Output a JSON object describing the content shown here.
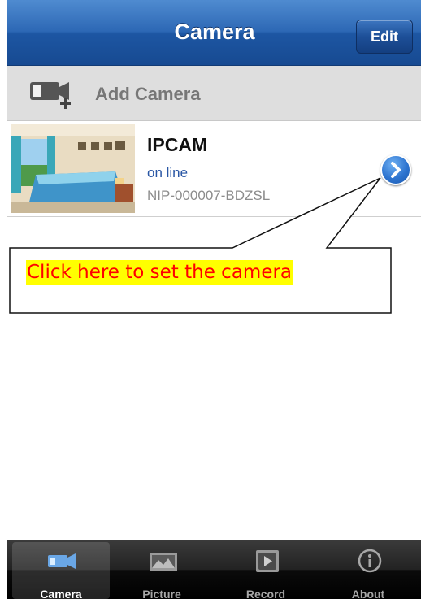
{
  "navbar": {
    "title": "Camera",
    "edit_label": "Edit"
  },
  "add_camera": {
    "label": "Add Camera",
    "icon": "add-camera-icon"
  },
  "camera": {
    "name": "IPCAM",
    "status": "on line",
    "id": "NIP-000007-BDZSL",
    "thumbnail": "bedroom-thumbnail"
  },
  "callout": {
    "text": "Click here to set the camera"
  },
  "tabs": [
    {
      "label": "Camera",
      "icon": "camera-icon",
      "active": true
    },
    {
      "label": "Picture",
      "icon": "picture-icon",
      "active": false
    },
    {
      "label": "Record",
      "icon": "record-icon",
      "active": false
    },
    {
      "label": "About",
      "icon": "info-icon",
      "active": false
    }
  ],
  "colors": {
    "navbar": "#2d68b5",
    "status_text": "#2a57a5",
    "callout_text": "#ff0000",
    "callout_highlight": "#ffff00"
  }
}
